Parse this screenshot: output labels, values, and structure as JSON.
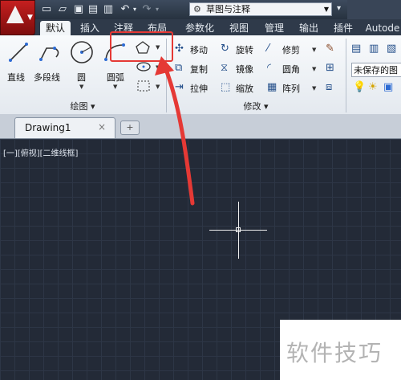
{
  "quick_access": {
    "workspace": "草图与注释",
    "icons": [
      "new-file-icon",
      "open-folder-icon",
      "save-icon",
      "save-as-icon",
      "plot-icon",
      "undo-icon",
      "redo-icon"
    ]
  },
  "tabs": [
    "默认",
    "插入",
    "注释",
    "布局",
    "参数化",
    "视图",
    "管理",
    "输出",
    "插件",
    "Autode"
  ],
  "active_tab": "默认",
  "ribbon": {
    "draw": {
      "title": "绘图",
      "tools": [
        "直线",
        "多段线",
        "圆",
        "圆弧"
      ]
    },
    "modify": {
      "title": "修改",
      "rows": [
        [
          "移动",
          "旋转",
          "修剪"
        ],
        [
          "复制",
          "镜像",
          "圆角"
        ],
        [
          "拉伸",
          "缩放",
          "阵列"
        ]
      ]
    },
    "layers": {
      "unsaved_state": "未保存的图"
    }
  },
  "file_tab": {
    "name": "Drawing1",
    "close": "×"
  },
  "canvas": {
    "viewport_label": "[一][俯视][二维线框]"
  },
  "watermark": "软件技巧",
  "colors": {
    "app_red": "#b71c1c",
    "annotation_red": "#e53935",
    "canvas_bg": "#232a37"
  }
}
